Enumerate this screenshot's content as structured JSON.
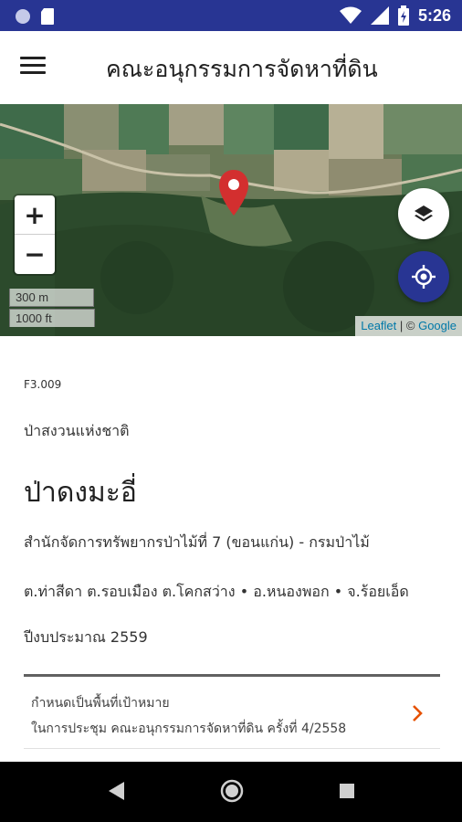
{
  "status_bar": {
    "time": "5:26",
    "left_icons": [
      "circle-status-icon",
      "sd-card-icon"
    ],
    "right_icons": [
      "wifi-icon",
      "signal-icon",
      "battery-icon"
    ]
  },
  "app_bar": {
    "menu_icon": "hamburger-menu-icon",
    "title": "คณะอนุกรรมการจัดหาที่ดิน"
  },
  "map": {
    "zoom_in": "+",
    "zoom_out": "−",
    "scale_metric": "300 m",
    "scale_imperial": "1000 ft",
    "attribution_leaflet": "Leaflet",
    "attribution_sep": " | © ",
    "attribution_google": "Google",
    "layers_icon": "layers-icon",
    "locate_icon": "my-location-icon",
    "pin_icon": "map-marker-icon",
    "pin_color": "#d32f2f"
  },
  "detail": {
    "code": "F3.009",
    "type": "ป่าสงวนแห่งชาติ",
    "name": "ป่าดงมะอี่",
    "agency": "สำนักจัดการทรัพยากรป่าไม้ที่ 7 (ขอนแก่น) - กรมป่าไม้",
    "location": "ต.ท่าสีดา ต.รอบเมือง ต.โคกสว่าง • อ.หนองพอก • จ.ร้อยเอ็ด",
    "budget": "ปีงบประมาณ 2559"
  },
  "card": {
    "line1": "กำหนดเป็นพื้นที่เป้าหมาย",
    "line2": "ในการประชุม คณะอนุกรรมการจัดหาที่ดิน ครั้งที่ 4/2558",
    "chevron_color": "#e65100"
  },
  "colors": {
    "primary": "#283593",
    "accent": "#e65100"
  },
  "nav_bar": {
    "icons": [
      "back-triangle-icon",
      "home-circle-icon",
      "recents-square-icon"
    ]
  }
}
